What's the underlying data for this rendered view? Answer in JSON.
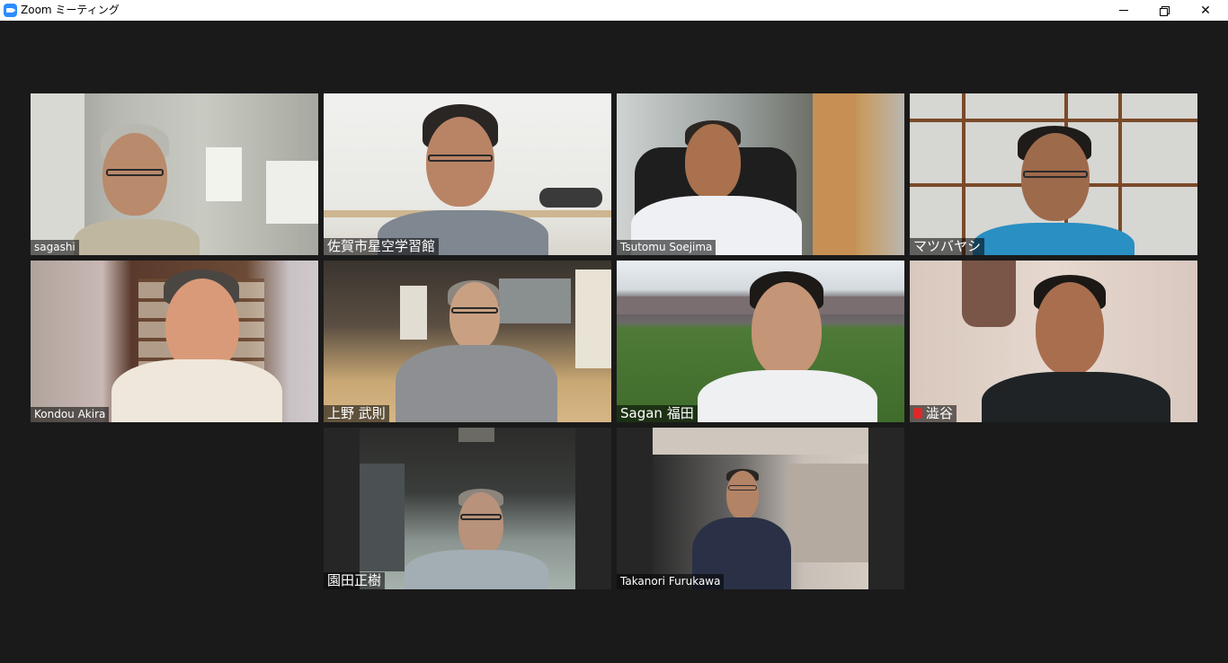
{
  "window": {
    "title": "Zoom ミーティング",
    "controls": {
      "minimize": "─",
      "close": "✕"
    }
  },
  "participants": [
    {
      "name": "sagashi",
      "active": false,
      "muted": false
    },
    {
      "name": "佐賀市星空学習館",
      "active": true,
      "muted": false
    },
    {
      "name": "Tsutomu Soejima",
      "active": false,
      "muted": false
    },
    {
      "name": "マツバヤシ",
      "active": false,
      "muted": false
    },
    {
      "name": "Kondou Akira",
      "active": false,
      "muted": false
    },
    {
      "name": "上野 武則",
      "active": false,
      "muted": false
    },
    {
      "name": "Sagan 福田",
      "active": false,
      "muted": false
    },
    {
      "name": "澁谷",
      "active": false,
      "muted": true
    },
    {
      "name": "園田正樹",
      "active": false,
      "muted": false
    },
    {
      "name": "Takanori Furukawa",
      "active": false,
      "muted": false
    }
  ],
  "colors": {
    "active_speaker_border": "#c6e13d",
    "meeting_background": "#1a1a1a",
    "mute_icon": "#e02828"
  }
}
